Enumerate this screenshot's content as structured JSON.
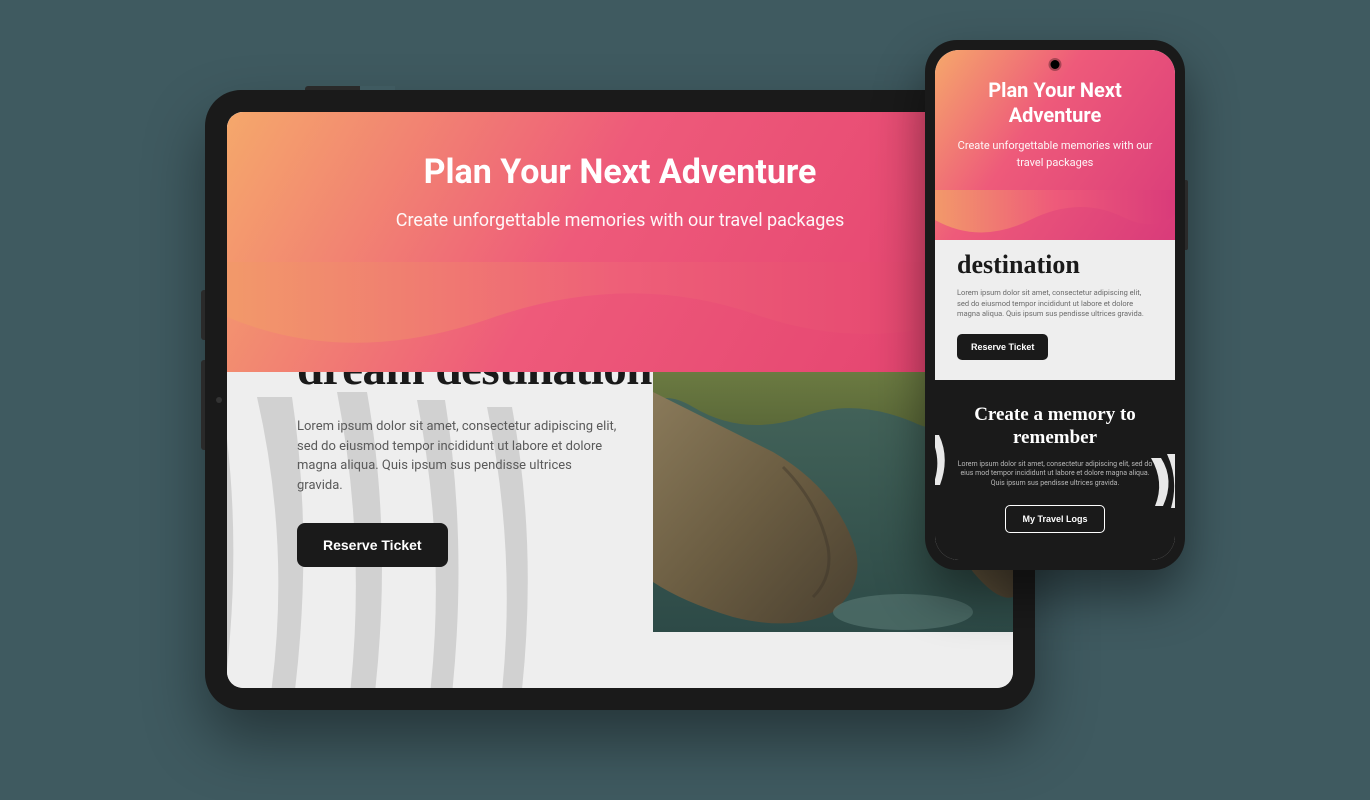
{
  "hero": {
    "title": "Plan Your Next Adventure",
    "subtitle": "Create unforgettable memories with our travel packages"
  },
  "section1": {
    "heading_full": "Travel to your dream destination",
    "heading_partial": "destination",
    "lorem": "Lorem ipsum dolor sit amet, consectetur adipiscing elit, sed do eiusmod tempor incididunt ut labore et dolore magna aliqua. Quis ipsum sus pendisse ultrices gravida.",
    "button": "Reserve Ticket"
  },
  "section2": {
    "heading": "Create a memory to remember",
    "lorem": "Lorem ipsum dolor sit amet, consectetur adipiscing elit, sed do eius mod tempor incididunt ut labore et dolore magna aliqua. Quis ipsum sus pendisse ultrices gravida.",
    "button": "My Travel Logs"
  },
  "colors": {
    "gradient_start": "#f5a86b",
    "gradient_mid": "#ee5a7a",
    "gradient_end": "#d93b7a",
    "dark": "#1a1a1a",
    "page_bg": "#3f5a60"
  }
}
